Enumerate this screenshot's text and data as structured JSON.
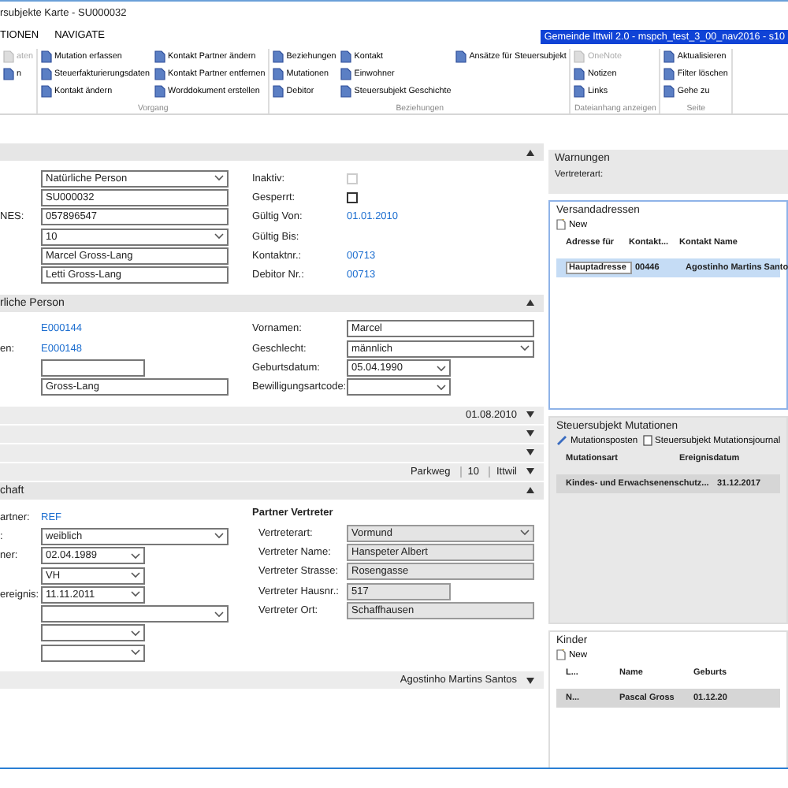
{
  "window": {
    "title": "rsubjekte Karte - SU000032"
  },
  "menu": {
    "tabs": [
      {
        "label": "TIONEN",
        "selected": false
      },
      {
        "label": "NAVIGATE",
        "selected": false
      }
    ],
    "environment": "Gemeinde Ittwil 2.0 - mspch_test_3_00_nav2016 - s10"
  },
  "ribbon": {
    "groups": [
      {
        "columns": [
          [
            {
              "label": "aten",
              "disabled": true
            },
            {
              "label": "n",
              "disabled": false
            }
          ]
        ]
      },
      {
        "label": "Vorgang",
        "columns": [
          [
            {
              "label": "Mutation erfassen",
              "disabled": false
            },
            {
              "label": "Steuerfakturierungsdaten",
              "disabled": false
            },
            {
              "label": "Kontakt ändern",
              "disabled": false
            }
          ],
          [
            {
              "label": "Kontakt Partner ändern",
              "disabled": false
            },
            {
              "label": "Kontakt Partner entfernen",
              "disabled": false
            },
            {
              "label": "Worddokument erstellen",
              "disabled": false
            }
          ]
        ]
      },
      {
        "label": "Beziehungen",
        "columns": [
          [
            {
              "label": "Beziehungen",
              "disabled": false
            },
            {
              "label": "Mutationen",
              "disabled": false
            },
            {
              "label": "Debitor",
              "disabled": false
            }
          ],
          [
            {
              "label": "Kontakt",
              "disabled": false
            },
            {
              "label": "Einwohner",
              "disabled": false
            },
            {
              "label": "Steuersubjekt Geschichte",
              "disabled": false
            }
          ],
          [
            {
              "label": "Ansätze für Steuersubjekt",
              "disabled": false
            }
          ]
        ]
      },
      {
        "label": "Dateianhang anzeigen",
        "columns": [
          [
            {
              "label": "OneNote",
              "disabled": true
            },
            {
              "label": "Notizen",
              "disabled": false
            },
            {
              "label": "Links",
              "disabled": false
            }
          ]
        ]
      },
      {
        "label": "Seite",
        "columns": [
          [
            {
              "label": "Aktualisieren",
              "disabled": false
            },
            {
              "label": "Filter löschen",
              "disabled": false
            },
            {
              "label": "Gehe zu",
              "disabled": false
            }
          ]
        ]
      }
    ]
  },
  "main": [
    {
      "kind": "header",
      "expanded": true
    },
    {
      "kind": "form",
      "left": [
        {
          "kind": "dropdown",
          "value": "Natürliche Person",
          "wide": true
        },
        {
          "kind": "text",
          "value": "SU000032",
          "wide": true
        },
        {
          "label": "NES:",
          "kind": "text",
          "value": "057896547",
          "wide": true
        },
        {
          "kind": "dropdown",
          "value": "10",
          "wide": true
        },
        {
          "kind": "text",
          "value": "Marcel Gross-Lang",
          "wide": true
        },
        {
          "kind": "text",
          "value": "Letti Gross-Lang",
          "wide": true
        }
      ],
      "right": [
        {
          "label": "Inaktiv:",
          "kind": "checkbox",
          "checked": false,
          "disabled": true
        },
        {
          "label": "Gesperrt:",
          "kind": "checkbox",
          "checked": false,
          "disabled": false
        },
        {
          "label": "Gültig Von:",
          "kind": "link",
          "value": "01.01.2010"
        },
        {
          "label": "Gültig Bis:",
          "kind": "empty"
        },
        {
          "label": "Kontaktnr.:",
          "kind": "link",
          "value": "00713"
        },
        {
          "label": "Debitor Nr.:",
          "kind": "link",
          "value": "00713"
        }
      ]
    },
    {
      "kind": "header",
      "title": "rliche Person",
      "expanded": true
    },
    {
      "kind": "form",
      "left": [
        {
          "kind": "link",
          "value": "E000144"
        },
        {
          "label": "en:",
          "kind": "link",
          "value": "E000148"
        },
        {
          "kind": "text",
          "wide": false
        },
        {
          "kind": "text",
          "value": "Gross-Lang",
          "wide": true
        }
      ],
      "right": [
        {
          "label": "Vornamen:",
          "kind": "text",
          "value": "Marcel",
          "wide": true
        },
        {
          "label": "Geschlecht:",
          "kind": "dropdown",
          "value": "männlich",
          "wide": true
        },
        {
          "label": "Geburtsdatum:",
          "kind": "dropdown",
          "value": "05.04.1990",
          "wide": false
        },
        {
          "label": "Bewilligungsartcode:",
          "kind": "dropdown",
          "wide": false
        }
      ]
    },
    {
      "kind": "bar",
      "texts": [
        "01.08.2010"
      ],
      "expanded": false
    },
    {
      "kind": "bar",
      "expanded": false
    },
    {
      "kind": "bar",
      "expanded": false
    },
    {
      "kind": "bar",
      "texts": [
        "Parkweg",
        "10",
        "Ittwil"
      ],
      "expanded": false
    },
    {
      "kind": "header",
      "title": "chaft",
      "expanded": true
    },
    {
      "kind": "form",
      "left": [
        {
          "label": "artner:",
          "kind": "link",
          "value": "REF"
        },
        {
          "label": ":",
          "kind": "dropdown",
          "value": "weiblich",
          "wide": true
        },
        {
          "label": "ner:",
          "kind": "dropdown",
          "value": "02.04.1989",
          "wide": false
        },
        {
          "kind": "dropdown",
          "value": "VH",
          "wide": false
        },
        {
          "label": "ereignis:",
          "kind": "dropdown",
          "value": "11.11.2011",
          "wide": false
        },
        {
          "kind": "dropdown",
          "wide": true
        },
        {
          "kind": "dropdown",
          "wide": false
        },
        {
          "kind": "dropdown",
          "wide": false
        }
      ],
      "heading": "Partner Vertreter",
      "right": [
        {
          "label": "Vertreterart:",
          "kind": "dropdown",
          "value": "Vormund",
          "wide": true,
          "readonly": true
        },
        {
          "label": "Vertreter Name:",
          "kind": "text",
          "value": "Hanspeter Albert",
          "wide": true,
          "readonly": true
        },
        {
          "label": "Vertreter Strasse:",
          "kind": "text",
          "value": "Rosengasse",
          "wide": true,
          "readonly": true
        },
        {
          "label": "Vertreter Hausnr.:",
          "kind": "text",
          "value": "517",
          "wide": false,
          "readonly": true
        },
        {
          "label": "Vertreter Ort:",
          "kind": "text",
          "value": "Schaffhausen",
          "wide": true,
          "readonly": true
        }
      ]
    },
    {
      "kind": "bar",
      "texts": [
        "Agostinho Martins Santos"
      ],
      "expanded": false
    }
  ],
  "panels": [
    {
      "kind": "info",
      "title": "Warnungen",
      "text": "Vertreterart:"
    },
    {
      "kind": "list",
      "title": "Versandadressen",
      "focused": true,
      "new_label": "New",
      "columns": [
        "Adresse für",
        "Kontakt...",
        "Kontakt Name"
      ],
      "rows": [
        {
          "cells": [
            "Hauptadresse",
            "00446",
            "Agostinho Martins Santo"
          ],
          "selected": true
        }
      ]
    },
    {
      "kind": "list",
      "title": "Steuersubjekt Mutationen",
      "focused": false,
      "actions": [
        "Mutationsposten",
        "Steuersubjekt Mutationsjournal"
      ],
      "columns": [
        "Mutationsart",
        "Ereignisdatum"
      ],
      "rows": [
        {
          "cells": [
            "Kindes- und Erwachsenenschutz...",
            "31.12.2017"
          ],
          "selected": true
        }
      ]
    },
    {
      "kind": "list",
      "title": "Kinder",
      "focused": false,
      "new_label": "New",
      "columns": [
        "L...",
        "Name",
        "Geburts"
      ],
      "rows": [
        {
          "cells": [
            "N...",
            "Pascal Gross",
            "01.12.20"
          ],
          "selected": true
        }
      ]
    }
  ]
}
